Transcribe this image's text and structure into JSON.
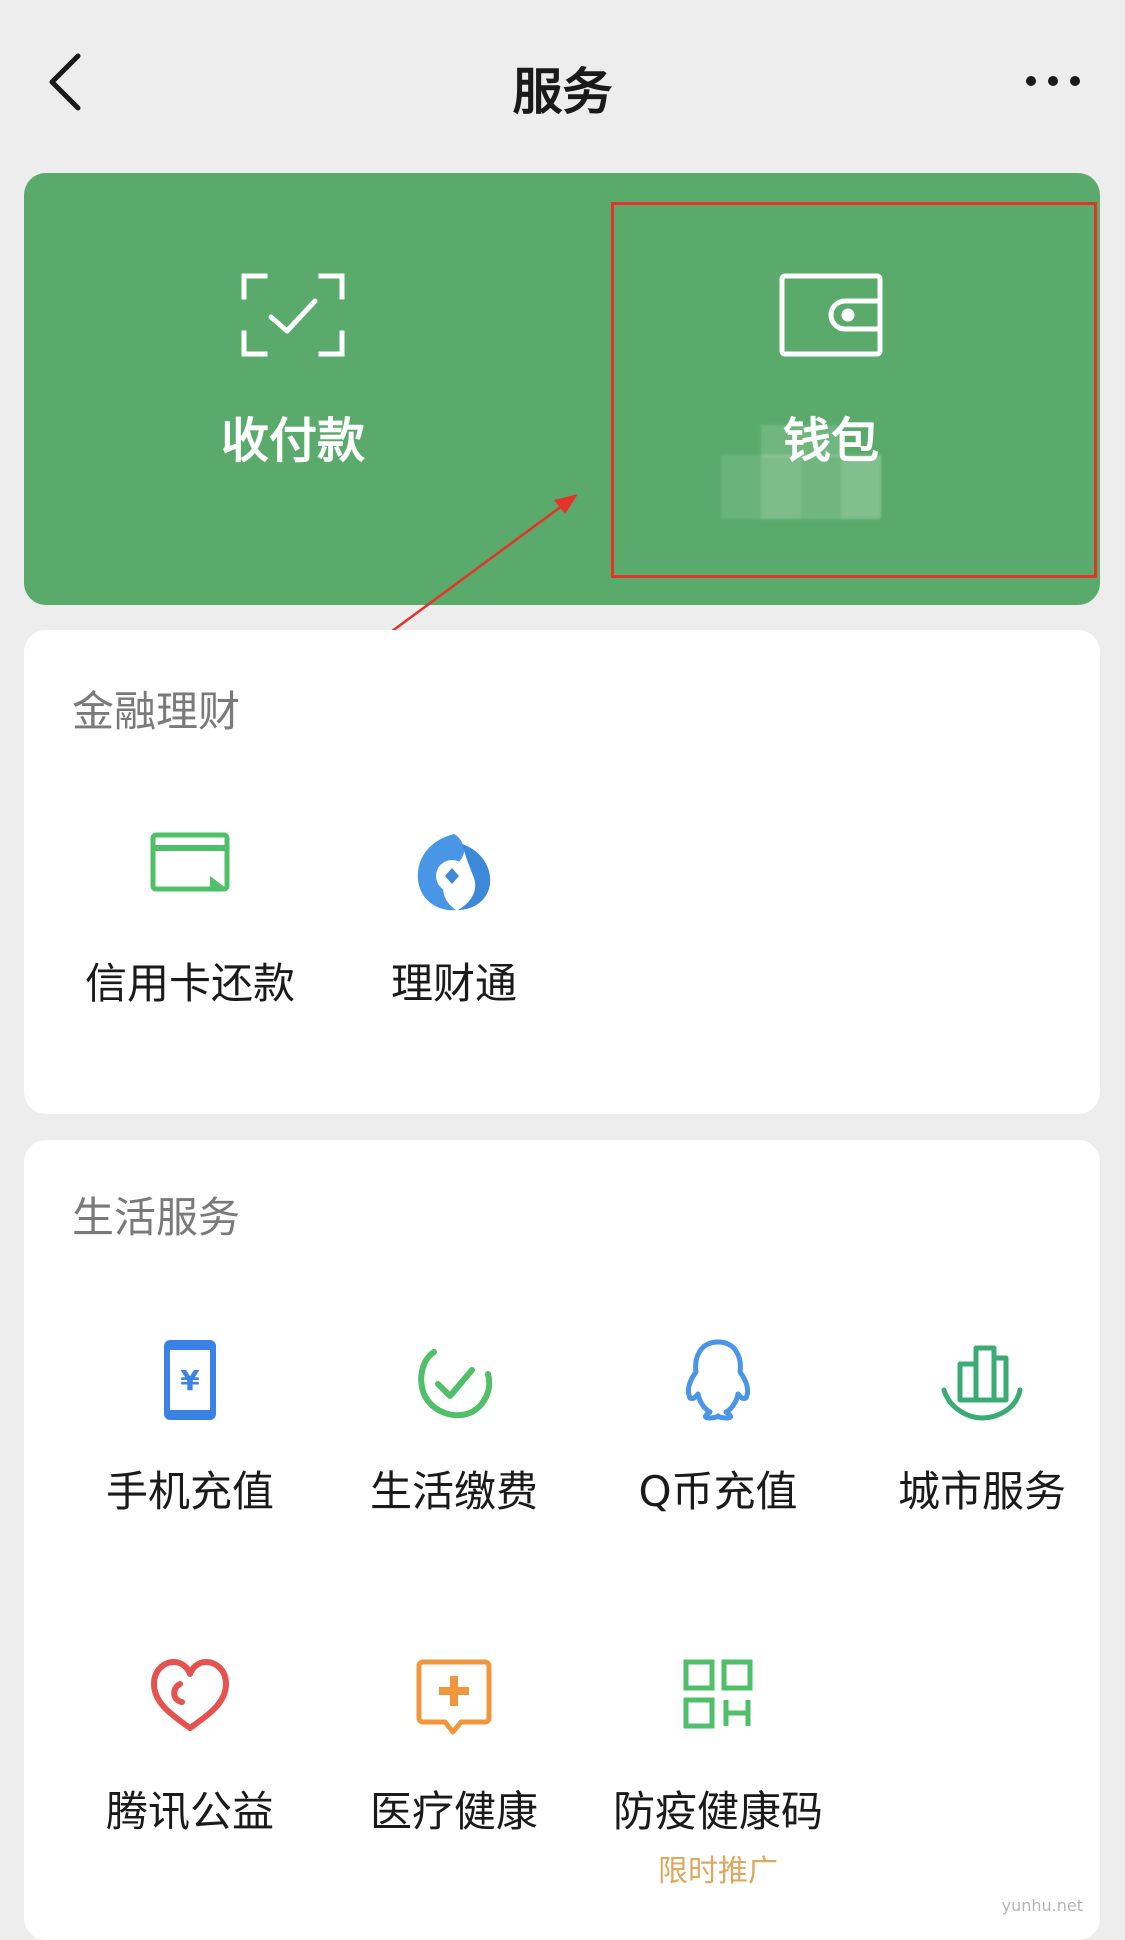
{
  "header": {
    "title": "服务"
  },
  "top_card": {
    "pay": {
      "label": "收付款"
    },
    "wallet": {
      "label": "钱包"
    }
  },
  "finance": {
    "title": "金融理财",
    "items": [
      {
        "label": "信用卡还款",
        "icon": "credit-card-icon"
      },
      {
        "label": "理财通",
        "icon": "licaitong-icon"
      }
    ]
  },
  "life": {
    "title": "生活服务",
    "items": [
      {
        "label": "手机充值",
        "icon": "phone-topup-icon"
      },
      {
        "label": "生活缴费",
        "icon": "utility-payment-icon"
      },
      {
        "label": "Q币充值",
        "icon": "qq-coin-icon"
      },
      {
        "label": "城市服务",
        "icon": "city-service-icon"
      },
      {
        "label": "腾讯公益",
        "icon": "charity-heart-icon"
      },
      {
        "label": "医疗健康",
        "icon": "medical-icon"
      },
      {
        "label": "防疫健康码",
        "icon": "health-code-icon",
        "badge": "限时推广"
      }
    ]
  },
  "watermark": "yunhu.net",
  "colors": {
    "green_card": "#5aab6b",
    "annotation_red": "#e5322b",
    "promo_orange": "#e0a75e"
  }
}
